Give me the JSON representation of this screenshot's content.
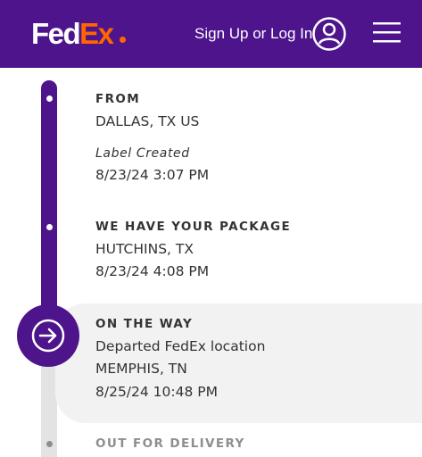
{
  "header": {
    "logo_fed": "Fed",
    "logo_ex": "Ex",
    "signin_label": "Sign Up or Log In",
    "user_icon": "user-circle-icon",
    "menu_icon": "hamburger-menu-icon"
  },
  "colors": {
    "brand_purple": "#4D148C",
    "brand_orange": "#FF6600",
    "active_bg": "#F2F2F2",
    "rail_gray": "#E3E3E3"
  },
  "timeline": [
    {
      "title": "FROM",
      "lines": [
        "DALLAS, TX US"
      ],
      "note": "Label Created",
      "timestamp": "8/23/24 3:07 PM",
      "state": "done"
    },
    {
      "title": "WE HAVE YOUR PACKAGE",
      "lines": [
        "HUTCHINS, TX"
      ],
      "timestamp": "8/23/24 4:08 PM",
      "state": "done"
    },
    {
      "title": "ON THE WAY",
      "lines": [
        "Departed FedEx location",
        "MEMPHIS, TN"
      ],
      "timestamp": "8/25/24 10:48 PM",
      "state": "current",
      "icon": "arrow-right-circle-icon"
    },
    {
      "title": "OUT FOR DELIVERY",
      "state": "pending"
    }
  ]
}
